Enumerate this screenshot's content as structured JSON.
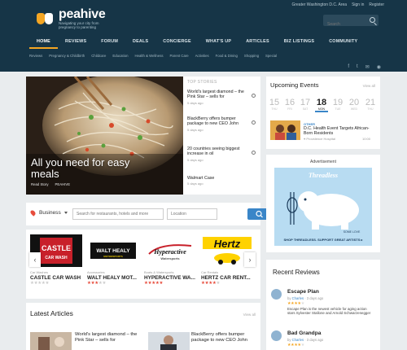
{
  "header": {
    "brand": "peahive",
    "tagline": "Navigating your city from pregnancy to parenting",
    "location": "Greater Washington D.C. Area",
    "sign_in": "Sign in",
    "register": "Register",
    "search_placeholder": "Search",
    "nav": [
      "HOME",
      "REVIEWS",
      "FORUM",
      "DEALS",
      "CONCIERGE",
      "WHAT'S UP",
      "ARTICLES",
      "BIZ LISTINGS",
      "COMMUNITY"
    ],
    "subnav": [
      "Reviews",
      "Pregnancy & Childbirth",
      "Childcare",
      "Education",
      "Health & Wellness",
      "Parent Care",
      "Activities",
      "Food & Dining",
      "Shopping",
      "Special"
    ]
  },
  "hero": {
    "title": "All you need for easy meals",
    "read_story": "Read Story",
    "source": "PEAHIVE"
  },
  "top_stories": {
    "label": "TOP STORIES",
    "items": [
      {
        "title": "World's largest diamond – the Pink Star – sells for",
        "ago": "5 days ago"
      },
      {
        "title": "BlackBerry offers bumper package to new CEO John",
        "ago": "5 days ago"
      },
      {
        "title": "20 countries seeing biggest increase in oil",
        "ago": "5 days ago"
      },
      {
        "title": "Walmart Case",
        "ago": "5 days ago"
      }
    ]
  },
  "business": {
    "label": "Business",
    "search_placeholder": "Search for restaurants, hotels and more",
    "location_placeholder": "Location",
    "cards": [
      {
        "logo": "CASTLE",
        "logo_sub": "CAR WASH",
        "category": "Car Washes",
        "name": "CASTLE CAR WASH",
        "rating": 0
      },
      {
        "logo": "WALT HEALY",
        "logo_sub": "MOTORSPORTS",
        "category": "Accessories",
        "name": "WALT HEALY MOT...",
        "rating": 3
      },
      {
        "logo": "Hyperactive",
        "logo_sub": "Watersports",
        "category": "Boats & Watersports",
        "name": "HYPERACTIVE WA...",
        "rating": 5
      },
      {
        "logo": "Hertz",
        "logo_sub": "",
        "category": "Car Rentals",
        "name": "HERTZ CAR RENT...",
        "rating": 4
      }
    ]
  },
  "latest": {
    "title": "Latest Articles",
    "view_all": "View all",
    "items": [
      "World's largest diamond – the Pink Star – sells for",
      "BlackBerry offers bumper package to new CEO John"
    ]
  },
  "events": {
    "title": "Upcoming Events",
    "view_all": "View all",
    "days": [
      {
        "num": "15",
        "dn": "THU"
      },
      {
        "num": "16",
        "dn": "FRI"
      },
      {
        "num": "17",
        "dn": "SAT"
      },
      {
        "num": "18",
        "dn": "MON"
      },
      {
        "num": "19",
        "dn": "TUE"
      },
      {
        "num": "20",
        "dn": "WED"
      },
      {
        "num": "21",
        "dn": "THU"
      }
    ],
    "category": "OTHER",
    "event_title": "D.C. Health Event Targets African-Born Residents",
    "location": "Providence Hospital",
    "time": "10:00"
  },
  "ad": {
    "label": "Advertisement",
    "brand": "Threadless",
    "slogan": "SHOP THREADLESS. SUPPORT GREAT ARTISTS ▸",
    "shirt": "SOME LOVE"
  },
  "reviews": {
    "title": "Recent Reviews",
    "items": [
      {
        "title": "Escape Plan",
        "by": "by",
        "author": "Charles",
        "time": "· 3 days ago",
        "stars": 4,
        "text": "Escape Plan is the newest vehicle for aging action stars Sylvester Stallone and Arnold Schwarzenegger"
      },
      {
        "title": "Bad Grandpa",
        "by": "by",
        "author": "Charles",
        "time": "· 3 days ago",
        "stars": 4,
        "text": ""
      }
    ]
  },
  "colors": {
    "header_bg": "#163547",
    "accent": "#f5a623",
    "link": "#3a86c8",
    "star_red": "#e74c3c"
  }
}
